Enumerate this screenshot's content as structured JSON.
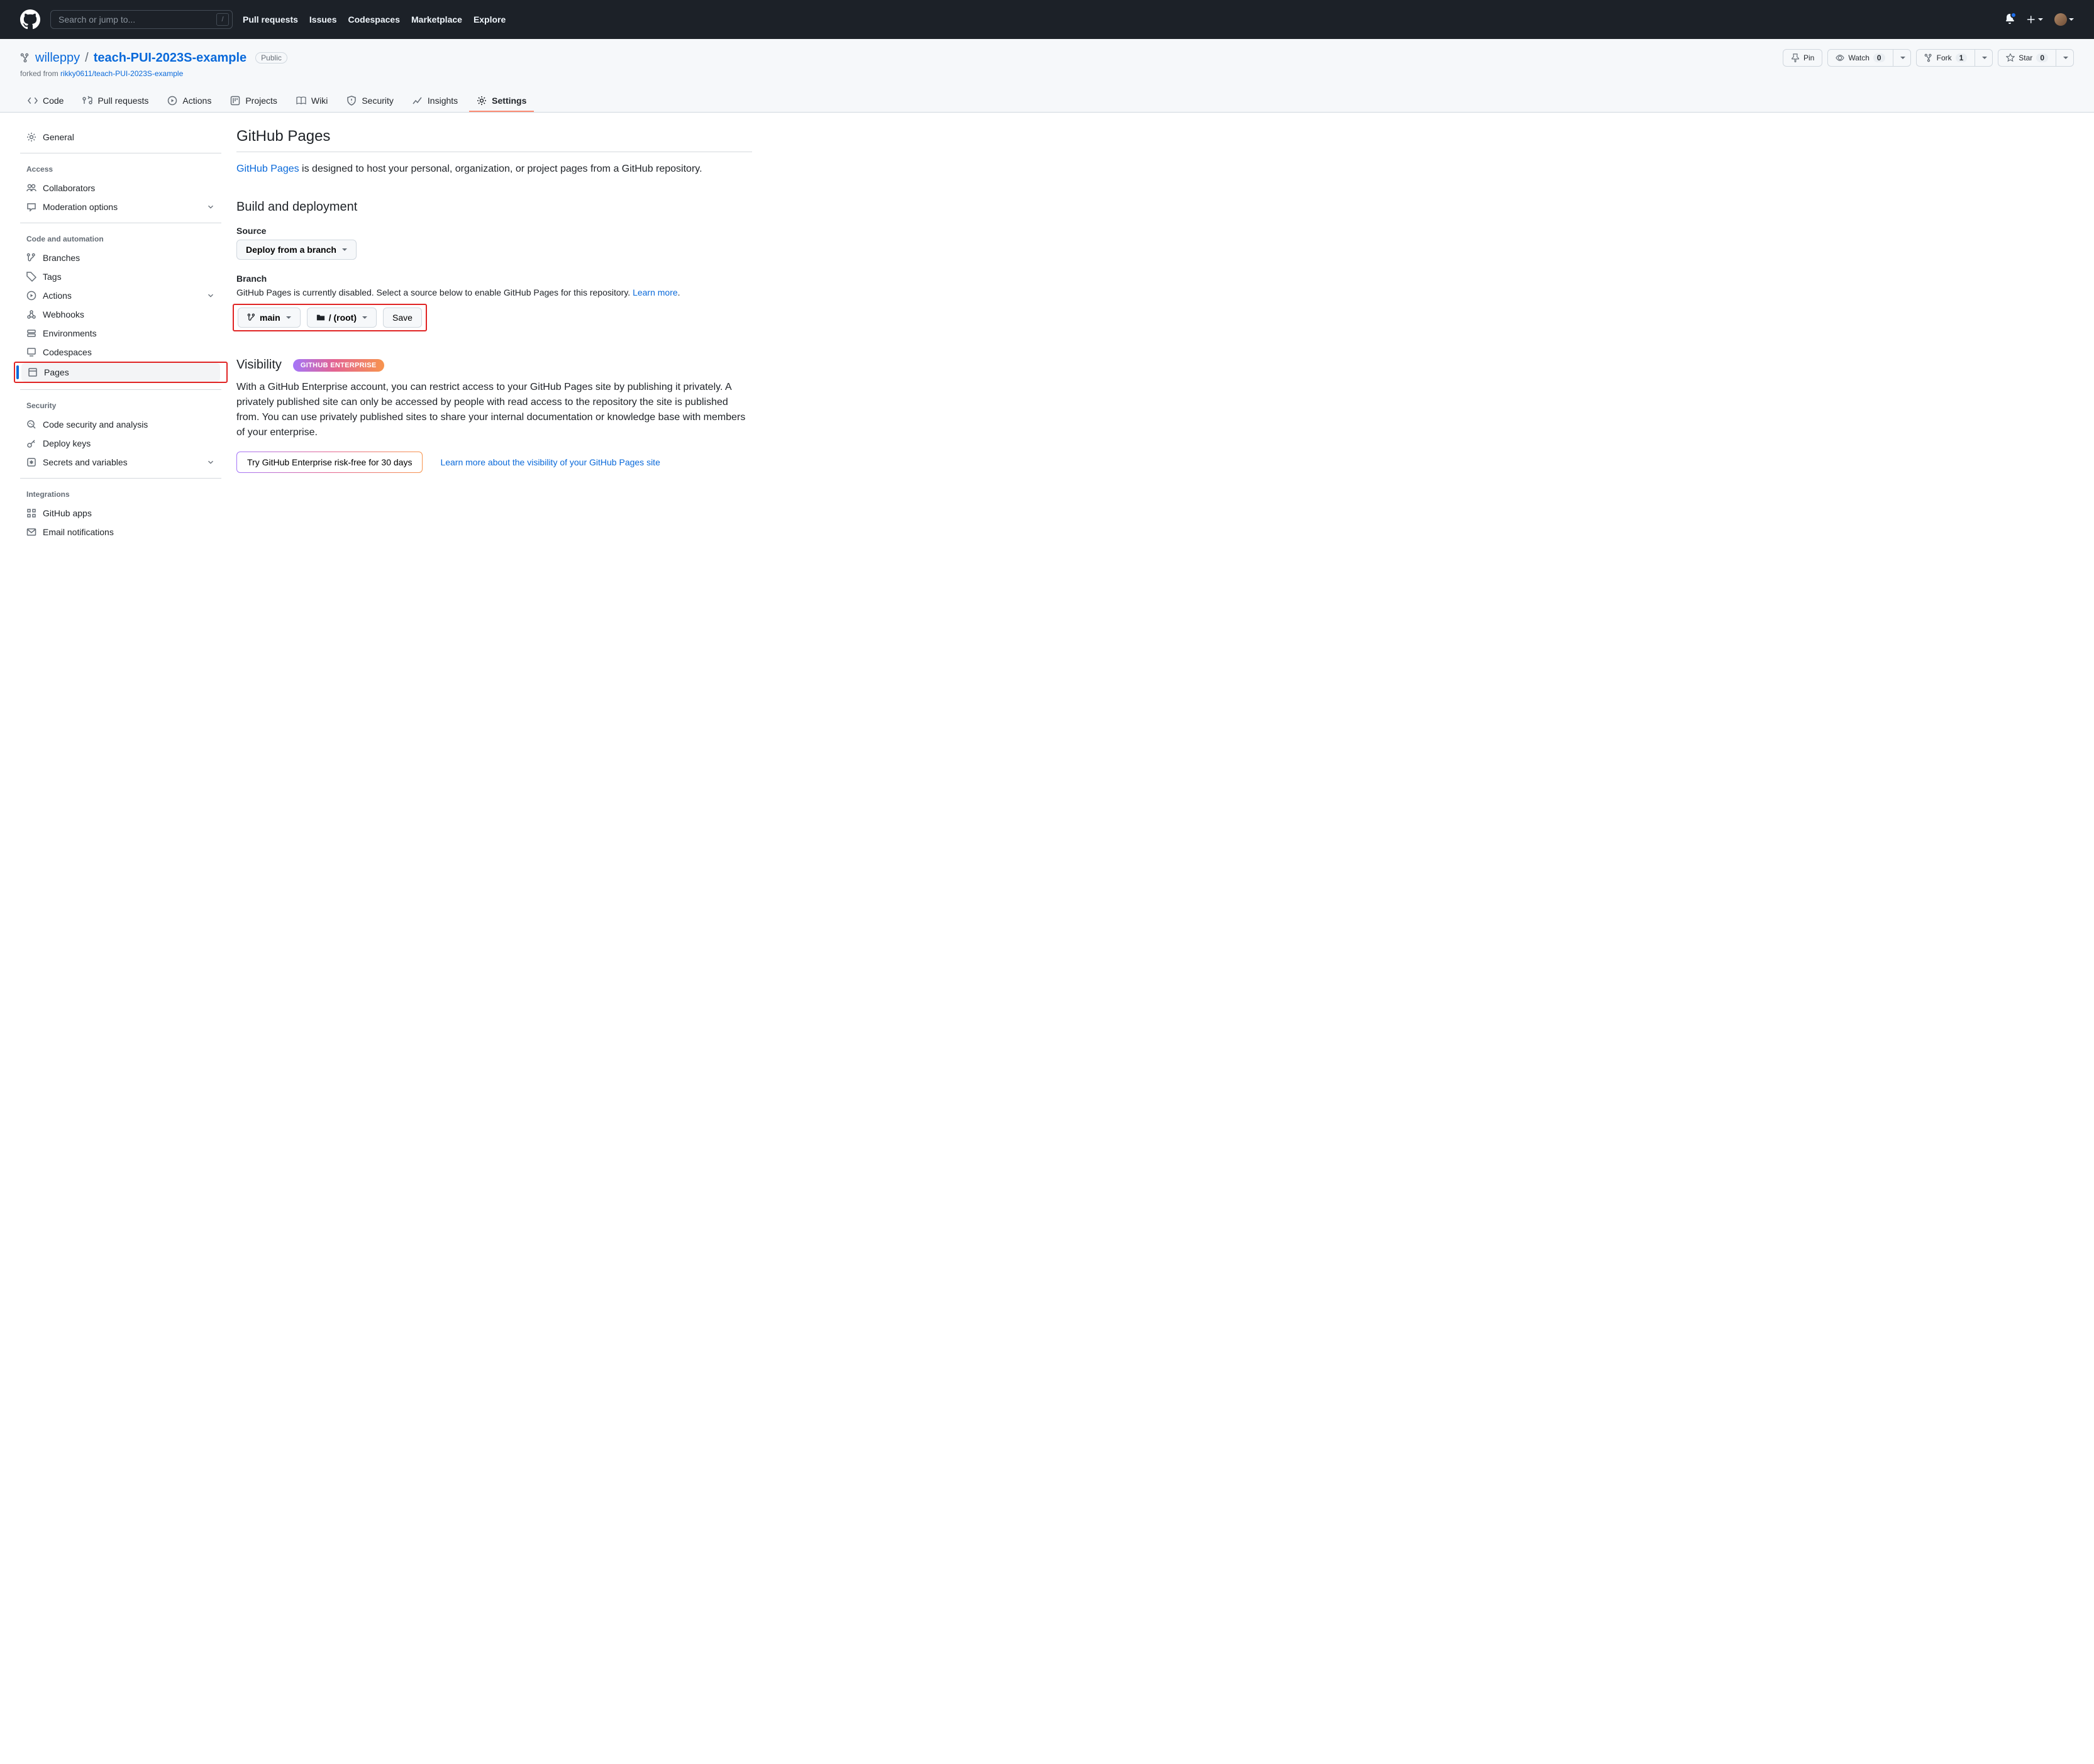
{
  "topbar": {
    "search_placeholder": "Search or jump to...",
    "slash": "/",
    "nav": [
      "Pull requests",
      "Issues",
      "Codespaces",
      "Marketplace",
      "Explore"
    ]
  },
  "repo": {
    "owner": "willeppy",
    "separator": "/",
    "name": "teach-PUI-2023S-example",
    "visibility": "Public",
    "forked_prefix": "forked from ",
    "forked_from": "rikky0611/teach-PUI-2023S-example",
    "actions": {
      "pin": "Pin",
      "watch": "Watch",
      "watch_count": "0",
      "fork": "Fork",
      "fork_count": "1",
      "star": "Star",
      "star_count": "0"
    }
  },
  "tabs": [
    "Code",
    "Pull requests",
    "Actions",
    "Projects",
    "Wiki",
    "Security",
    "Insights",
    "Settings"
  ],
  "sidebar": {
    "general": "General",
    "access_heading": "Access",
    "access": {
      "collaborators": "Collaborators",
      "moderation": "Moderation options"
    },
    "code_heading": "Code and automation",
    "code": {
      "branches": "Branches",
      "tags": "Tags",
      "actions": "Actions",
      "webhooks": "Webhooks",
      "environments": "Environments",
      "codespaces": "Codespaces",
      "pages": "Pages"
    },
    "security_heading": "Security",
    "security": {
      "analysis": "Code security and analysis",
      "deploy": "Deploy keys",
      "secrets": "Secrets and variables"
    },
    "integrations_heading": "Integrations",
    "integrations": {
      "apps": "GitHub apps",
      "email": "Email notifications"
    }
  },
  "page": {
    "title": "GitHub Pages",
    "link_text": "GitHub Pages",
    "desc_suffix": " is designed to host your personal, organization, or project pages from a GitHub repository.",
    "build_heading": "Build and deployment",
    "source_label": "Source",
    "source_value": "Deploy from a branch",
    "branch_label": "Branch",
    "branch_help_prefix": "GitHub Pages is currently disabled. Select a source below to enable GitHub Pages for this repository. ",
    "learn_more": "Learn more",
    "branch_help_suffix": ".",
    "branch_value": "main",
    "folder_value": "/ (root)",
    "save": "Save",
    "visibility_heading": "Visibility",
    "enterprise_badge": "GITHUB ENTERPRISE",
    "visibility_body": "With a GitHub Enterprise account, you can restrict access to your GitHub Pages site by publishing it privately. A privately published site can only be accessed by people with read access to the repository the site is published from. You can use privately published sites to share your internal documentation or knowledge base with members of your enterprise.",
    "try_button": "Try GitHub Enterprise risk-free for 30 days",
    "visibility_learn": "Learn more about the visibility of your GitHub Pages site"
  }
}
